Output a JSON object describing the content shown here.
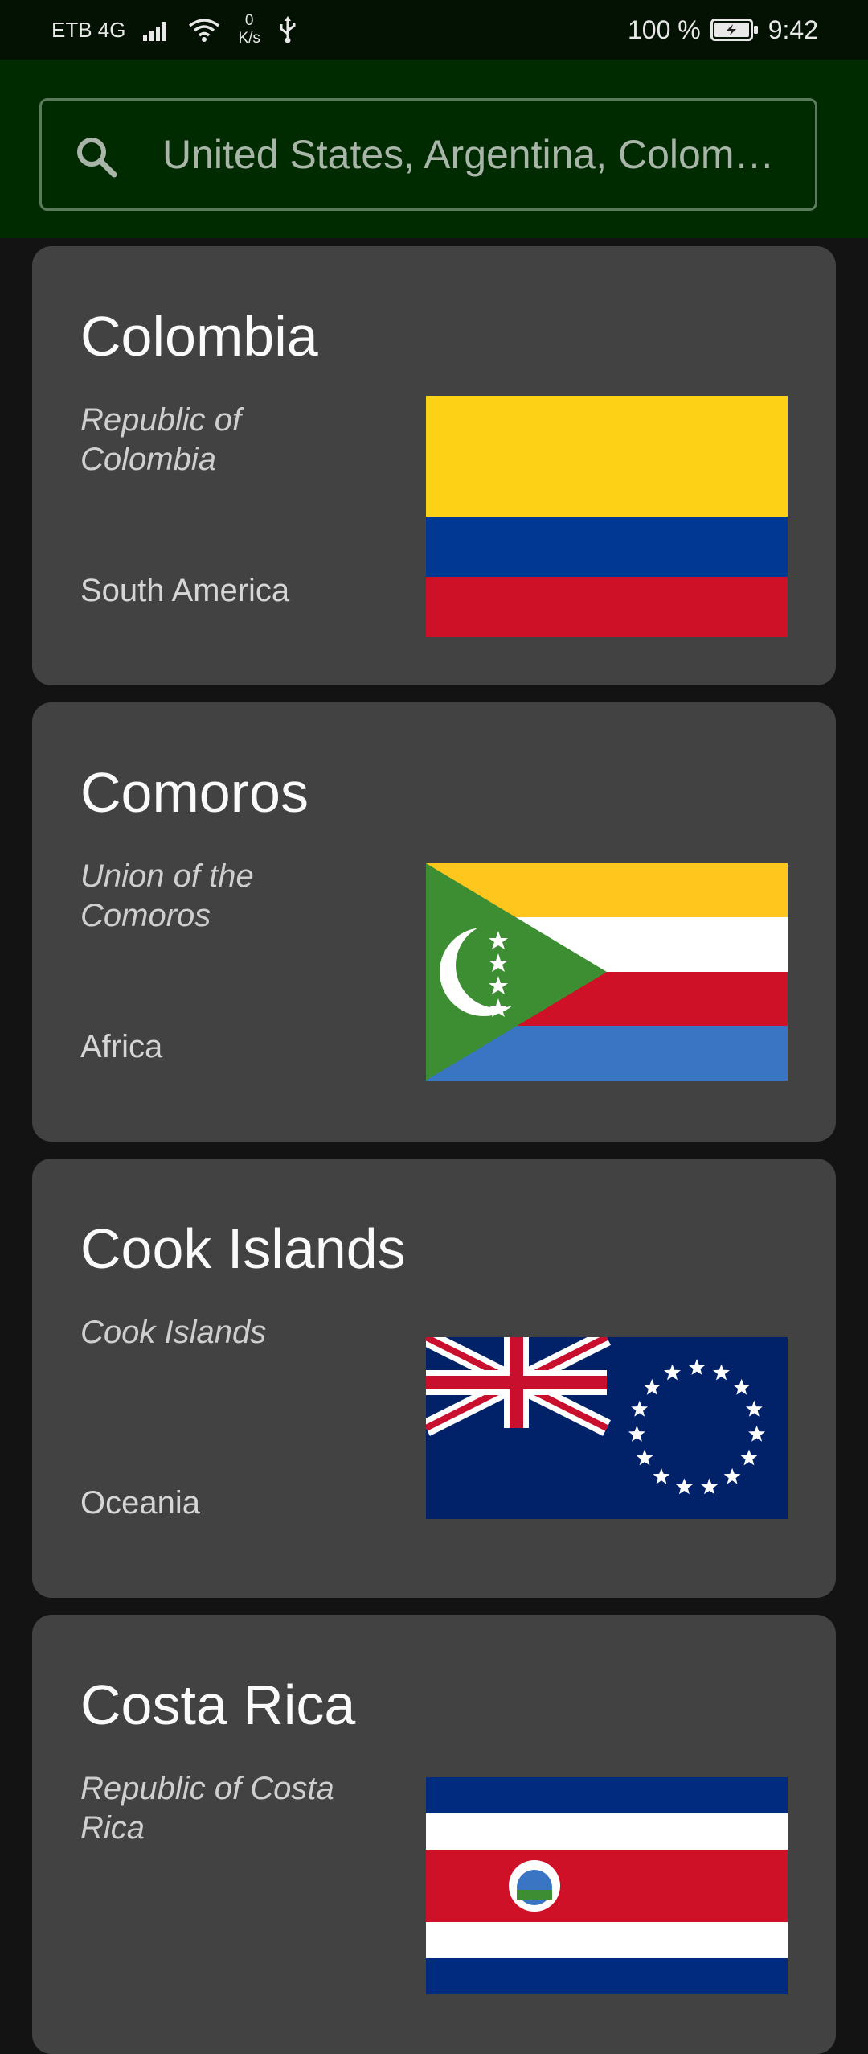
{
  "status_bar": {
    "carrier": "ETB 4G",
    "speed_value": "0",
    "speed_unit": "K/s",
    "battery": "100 %",
    "time": "9:42"
  },
  "search": {
    "placeholder": "United States, Argentina, Colom…",
    "value": ""
  },
  "countries": [
    {
      "name": "Colombia",
      "official": "Republic of Colombia",
      "region": "South America",
      "flag_icon": "colombia-flag"
    },
    {
      "name": "Comoros",
      "official": "Union of the Comoros",
      "region": "Africa",
      "flag_icon": "comoros-flag"
    },
    {
      "name": "Cook Islands",
      "official": "Cook Islands",
      "region": "Oceania",
      "flag_icon": "cook-islands-flag"
    },
    {
      "name": "Costa Rica",
      "official": "Republic of Costa Rica",
      "region": "",
      "flag_icon": "costa-rica-flag"
    }
  ],
  "colors": {
    "background": "#131313",
    "appbar": "#002a00",
    "card": "#424242"
  }
}
